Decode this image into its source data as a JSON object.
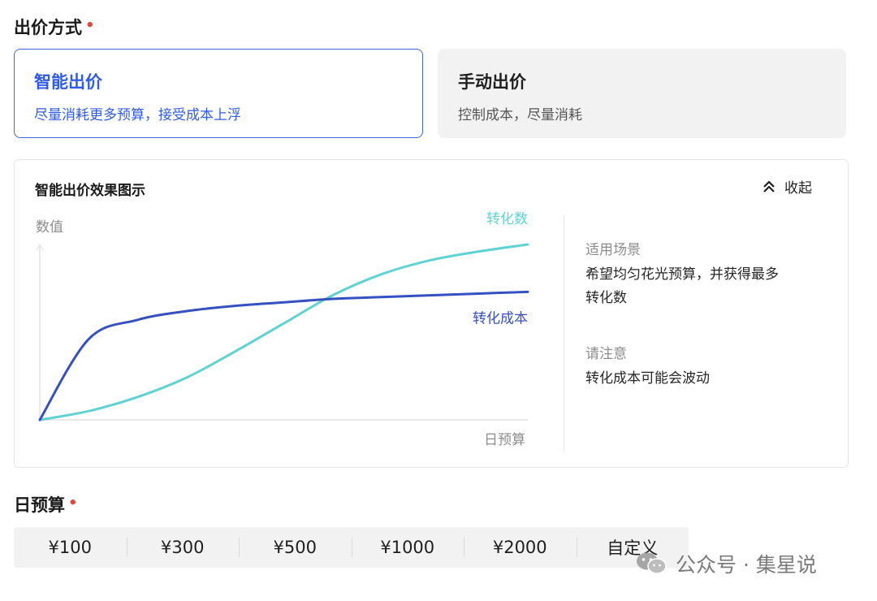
{
  "bid_method": {
    "title": "出价方式",
    "required_mark": "•",
    "options": [
      {
        "title": "智能出价",
        "desc": "尽量消耗更多预算，接受成本上浮",
        "selected": true
      },
      {
        "title": "手动出价",
        "desc": "控制成本，尽量消耗",
        "selected": false
      }
    ]
  },
  "effect_panel": {
    "title": "智能出价效果图示",
    "collapse_label": "收起",
    "collapse_icon": "chevron-up-icon",
    "info": {
      "scene_label": "适用场景",
      "scene_text_line1": "希望均匀花光预算，并获得最多",
      "scene_text_line2": "转化数",
      "notice_label": "请注意",
      "notice_text": "转化成本可能会波动"
    }
  },
  "chart_data": {
    "type": "line",
    "ylabel": "数值",
    "xlabel": "日预算",
    "x": [
      0,
      0.1,
      0.2,
      0.3,
      0.4,
      0.5,
      0.6,
      0.7,
      0.8,
      0.9,
      1.0
    ],
    "series": [
      {
        "name": "转化数",
        "color": "#5fd3d3",
        "values": [
          0,
          0.05,
          0.13,
          0.24,
          0.39,
          0.55,
          0.71,
          0.83,
          0.91,
          0.96,
          1.0
        ]
      },
      {
        "name": "转化成本",
        "color": "#3550c0",
        "values": [
          0,
          0.46,
          0.57,
          0.62,
          0.65,
          0.67,
          0.69,
          0.7,
          0.71,
          0.72,
          0.73
        ]
      }
    ],
    "ylim": [
      0,
      1
    ],
    "grid": false,
    "legend": "inline-labels"
  },
  "daily_budget": {
    "title": "日预算",
    "required_mark": "•",
    "options": [
      "¥100",
      "¥300",
      "¥500",
      "¥1000",
      "¥2000",
      "自定义"
    ]
  },
  "footer": {
    "brand": "公众号 · 集星说",
    "icon": "wechat-icon"
  }
}
